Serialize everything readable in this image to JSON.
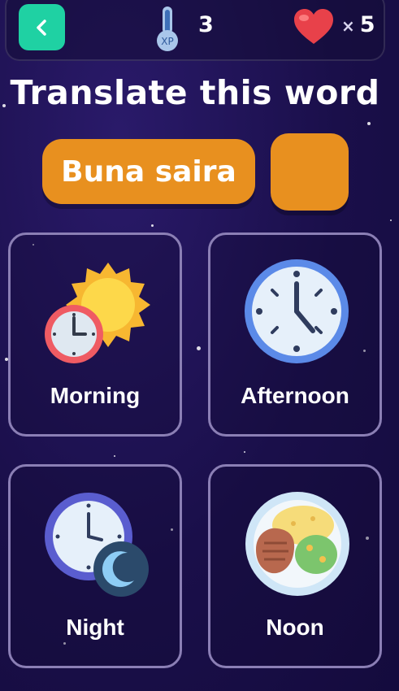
{
  "header": {
    "xp_label": "XP",
    "xp_count": "3",
    "lives_multiplier": "×",
    "lives_count": "5"
  },
  "question": {
    "title": "Translate this word",
    "word": "Buna saira"
  },
  "options": [
    {
      "label": "Morning",
      "icon": "sun-clock-icon"
    },
    {
      "label": "Afternoon",
      "icon": "clock-icon"
    },
    {
      "label": "Night",
      "icon": "moon-clock-icon"
    },
    {
      "label": "Noon",
      "icon": "meal-plate-icon"
    }
  ],
  "colors": {
    "back_button": "#1fd1a3",
    "accent_orange": "#e8901f",
    "card_border": "#8b7fb5"
  }
}
